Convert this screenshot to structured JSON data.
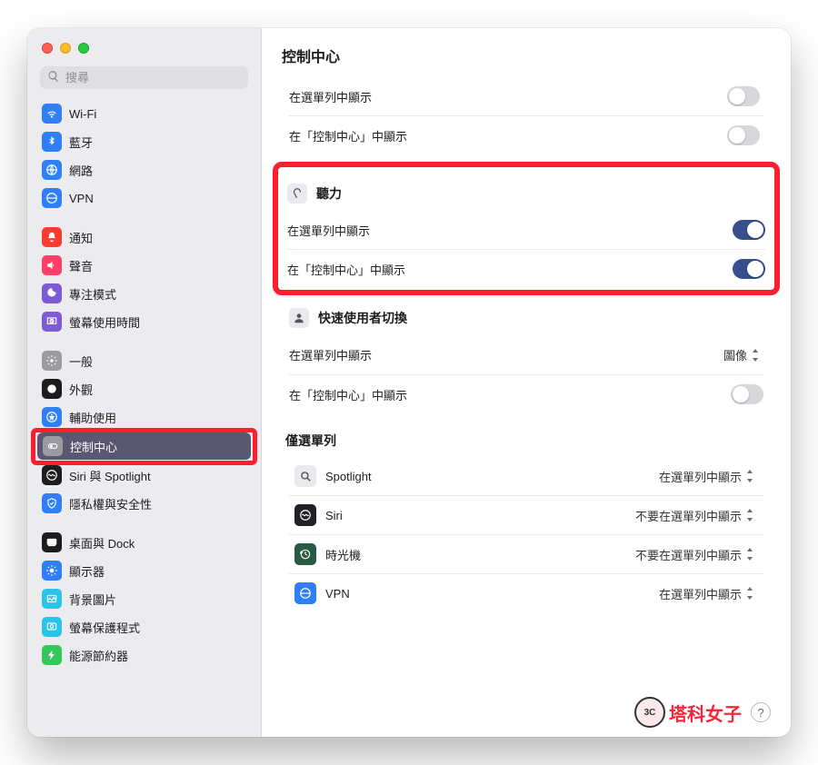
{
  "window": {
    "title": "控制中心"
  },
  "search": {
    "placeholder": "搜尋"
  },
  "sidebar": {
    "groups": [
      [
        {
          "icon": "wifi",
          "label": "Wi-Fi",
          "bg": "#2f7ff6"
        },
        {
          "icon": "bluetooth",
          "label": "藍牙",
          "bg": "#2f7ff6"
        },
        {
          "icon": "network",
          "label": "網路",
          "bg": "#2f7ff6"
        },
        {
          "icon": "vpn",
          "label": "VPN",
          "bg": "#2f7ff6"
        }
      ],
      [
        {
          "icon": "notifications",
          "label": "通知",
          "bg": "#ff3b30"
        },
        {
          "icon": "sound",
          "label": "聲音",
          "bg": "#ff3f67"
        },
        {
          "icon": "focus",
          "label": "專注模式",
          "bg": "#7e5bd6"
        },
        {
          "icon": "screentime",
          "label": "螢幕使用時間",
          "bg": "#7e5bd6"
        }
      ],
      [
        {
          "icon": "general",
          "label": "一般",
          "bg": "#9b9ba1"
        },
        {
          "icon": "appearance",
          "label": "外觀",
          "bg": "#1d1d1f"
        },
        {
          "icon": "accessibility",
          "label": "輔助使用",
          "bg": "#2f7ff6"
        },
        {
          "icon": "controlcenter",
          "label": "控制中心",
          "bg": "#9b9ba1",
          "selected": true,
          "highlight": true
        },
        {
          "icon": "siri",
          "label": "Siri 與 Spotlight",
          "bg": "#1d1d1f"
        },
        {
          "icon": "privacy",
          "label": "隱私權與安全性",
          "bg": "#2f7ff6"
        }
      ],
      [
        {
          "icon": "desktop",
          "label": "桌面與 Dock",
          "bg": "#1d1d1f"
        },
        {
          "icon": "displays",
          "label": "顯示器",
          "bg": "#2f7ff6"
        },
        {
          "icon": "wallpaper",
          "label": "背景圖片",
          "bg": "#29c4e8"
        },
        {
          "icon": "screensaver",
          "label": "螢幕保護程式",
          "bg": "#29c4e8"
        },
        {
          "icon": "energy",
          "label": "能源節約器",
          "bg": "#34c759"
        }
      ]
    ]
  },
  "top_fragment": {
    "row1_label": "在選單列中顯示",
    "row1_on": false,
    "row2_label": "在「控制中心」中顯示",
    "row2_on": false
  },
  "hearing": {
    "title": "聽力",
    "row1_label": "在選單列中顯示",
    "row1_on": true,
    "row2_label": "在「控制中心」中顯示",
    "row2_on": true
  },
  "fast_user": {
    "title": "快速使用者切換",
    "row1_label": "在選單列中顯示",
    "row1_value": "圖像",
    "row2_label": "在「控制中心」中顯示",
    "row2_on": false
  },
  "menu_only": {
    "group_title": "僅選單列",
    "items": [
      {
        "icon": "spotlight",
        "label": "Spotlight",
        "value": "在選單列中顯示",
        "bg": "#e9e9ee",
        "fg": "#555"
      },
      {
        "icon": "siri",
        "label": "Siri",
        "value": "不要在選單列中顯示",
        "bg": "#212029",
        "fg": "#fff"
      },
      {
        "icon": "timemachine",
        "label": "時光機",
        "value": "不要在選單列中顯示",
        "bg": "#2a5a42",
        "fg": "#fff"
      },
      {
        "icon": "vpn",
        "label": "VPN",
        "value": "在選單列中顯示",
        "bg": "#2f7ff6",
        "fg": "#fff"
      }
    ]
  },
  "watermark": {
    "text": "塔科女子"
  },
  "help": {
    "label": "?"
  }
}
